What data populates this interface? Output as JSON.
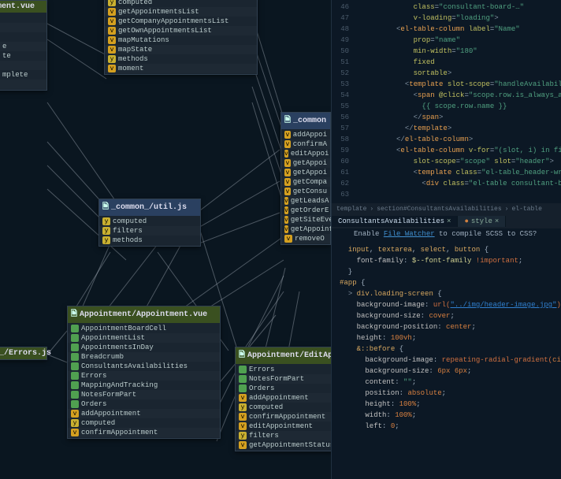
{
  "graph": {
    "nodes": {
      "nment": {
        "title": "nment.vue",
        "partial": true,
        "items": [
          {
            "icon": "g",
            "label": ""
          },
          {
            "icon": "g",
            "label": ""
          },
          {
            "icon": "g",
            "label": ""
          },
          {
            "icon": "b",
            "label": "e"
          },
          {
            "icon": "g",
            "label": "te"
          },
          {
            "icon": "g",
            "label": ""
          },
          {
            "icon": "b",
            "label": "mplete"
          },
          {
            "icon": "g",
            "label": ""
          }
        ]
      },
      "top": {
        "items": [
          {
            "icon": "y",
            "label": "computed"
          },
          {
            "icon": "v",
            "label": "getAppointmentsList"
          },
          {
            "icon": "v",
            "label": "getCompanyAppointmentsList"
          },
          {
            "icon": "v",
            "label": "getOwnAppointmentsList"
          },
          {
            "icon": "v",
            "label": "mapMutations"
          },
          {
            "icon": "v",
            "label": "mapState"
          },
          {
            "icon": "y",
            "label": "methods"
          },
          {
            "icon": "v",
            "label": "moment"
          }
        ]
      },
      "common_right": {
        "title": "_common",
        "headerClass": "alt",
        "items": [
          {
            "icon": "v",
            "label": "addAppoi"
          },
          {
            "icon": "v",
            "label": "confirmA"
          },
          {
            "icon": "v",
            "label": "editAppoi"
          },
          {
            "icon": "v",
            "label": "getAppoi"
          },
          {
            "icon": "v",
            "label": "getAppoi"
          },
          {
            "icon": "v",
            "label": "getCompa"
          },
          {
            "icon": "v",
            "label": "getConsu"
          },
          {
            "icon": "v",
            "label": "getLeadsA"
          },
          {
            "icon": "v",
            "label": "getOrderE"
          },
          {
            "icon": "v",
            "label": "getSiteEve"
          },
          {
            "icon": "v",
            "label": "getAppointmentStatusList"
          },
          {
            "icon": "v",
            "label": "removeO"
          }
        ]
      },
      "util": {
        "title": "_common_/util.js",
        "headerClass": "alt",
        "items": [
          {
            "icon": "y",
            "label": "computed"
          },
          {
            "icon": "y",
            "label": "filters"
          },
          {
            "icon": "y",
            "label": "methods"
          }
        ]
      },
      "appointment": {
        "title": "Appointment/Appointment.vue",
        "items": [
          {
            "icon": "g",
            "label": "AppointmentBoardCell"
          },
          {
            "icon": "g",
            "label": "AppointmentList"
          },
          {
            "icon": "g",
            "label": "AppointmentsInDay"
          },
          {
            "icon": "g",
            "label": "Breadcrumb"
          },
          {
            "icon": "g",
            "label": "ConsultantsAvailabilities"
          },
          {
            "icon": "g",
            "label": "Errors"
          },
          {
            "icon": "g",
            "label": "MappingAndTracking"
          },
          {
            "icon": "g",
            "label": "NotesFormPart"
          },
          {
            "icon": "g",
            "label": "Orders"
          },
          {
            "icon": "v",
            "label": "addAppointment"
          },
          {
            "icon": "y",
            "label": "computed"
          },
          {
            "icon": "v",
            "label": "confirmAppointment"
          }
        ]
      },
      "errors": {
        "title": "on_/Errors.js"
      },
      "edit": {
        "title": "Appointment/EditAppointment.vue",
        "items": [
          {
            "icon": "g",
            "label": "Errors"
          },
          {
            "icon": "g",
            "label": "NotesFormPart"
          },
          {
            "icon": "g",
            "label": "Orders"
          },
          {
            "icon": "v",
            "label": "addAppointment"
          },
          {
            "icon": "y",
            "label": "computed"
          },
          {
            "icon": "v",
            "label": "confirmAppointment"
          },
          {
            "icon": "v",
            "label": "editAppointment"
          },
          {
            "icon": "y",
            "label": "filters"
          },
          {
            "icon": "v",
            "label": "getAppointmentStatusList"
          }
        ]
      }
    }
  },
  "editor_top": {
    "line_start": 46,
    "lines": [
      {
        "indent": 14,
        "html": "<span class='attr'>class</span>=<span class='str'>\"consultant-board-…\"</span>"
      },
      {
        "indent": 14,
        "html": "<span class='attr'>v-loading</span>=<span class='str'>\"loading\"</span><span class='punct'>&gt;</span>"
      },
      {
        "indent": 10,
        "html": "<span class='punct'>&lt;</span><span class='tag'>el-table-column</span> <span class='attr'>label</span>=<span class='str'>\"Name\"</span>"
      },
      {
        "indent": 14,
        "html": "<span class='attr'>prop</span>=<span class='str'>\"name\"</span>"
      },
      {
        "indent": 14,
        "html": "<span class='attr'>min-width</span>=<span class='str'>\"180\"</span>"
      },
      {
        "indent": 14,
        "html": "<span class='attr'>fixed</span>"
      },
      {
        "indent": 14,
        "html": "<span class='attr'>sortable</span><span class='punct'>&gt;</span>"
      },
      {
        "indent": 12,
        "html": "<span class='punct'>&lt;</span><span class='tag'>template</span> <span class='attr'>slot-scope</span>=<span class='str'>\"handleAvailability(scope.row)\"</span>"
      },
      {
        "indent": 14,
        "html": "<span class='punct'>&lt;</span><span class='tag'>span</span> <span class='attr'>@click</span>=<span class='str'>\"scope.row.is_always_available ?</span>"
      },
      {
        "indent": 16,
        "html": "<span class='str'>{{ scope.row.name }}</span>"
      },
      {
        "indent": 14,
        "html": "<span class='punct'>&lt;/</span><span class='tag'>span</span><span class='punct'>&gt;</span>"
      },
      {
        "indent": 12,
        "html": "<span class='punct'>&lt;/</span><span class='tag'>template</span><span class='punct'>&gt;</span>"
      },
      {
        "indent": 10,
        "html": "<span class='punct'>&lt;/</span><span class='tag'>el-table-column</span><span class='punct'>&gt;</span>"
      },
      {
        "indent": 0,
        "html": ""
      },
      {
        "indent": 10,
        "html": "<span class='punct'>&lt;</span><span class='tag'>el-table-column</span> <span class='attr'>v-for</span>=<span class='str'>\"(slot, i) in firstHeader\"</span> <span class='attr'>:k</span>"
      },
      {
        "indent": 14,
        "html": "<span class='attr'>slot-scope</span>=<span class='str'>\"scope\"</span> <span class='attr'>slot</span>=<span class='str'>\"header\"</span><span class='punct'>&gt;</span>"
      },
      {
        "indent": 14,
        "html": "<span class='punct'>&lt;</span><span class='tag'>template</span> <span class='attr'>class</span>=<span class='str'>\"el-table_header-wrap\"</span><span class='punct'>&gt;</span>"
      },
      {
        "indent": 16,
        "html": "<span class='punct'>&lt;</span><span class='tag'>div</span> <span class='attr'>class</span>=<span class='str'>\"el-table consultant-board-ta</span>"
      }
    ]
  },
  "editor_bottom": {
    "breadcrumb": [
      "template",
      "section#ConsultantsAvailabilities",
      "el-table"
    ],
    "tabs": [
      {
        "label": "ConsultantsAvailabilities",
        "active": true,
        "close": true
      },
      {
        "label": "style",
        "active": false,
        "close": true
      }
    ],
    "tip_prefix": "Enable ",
    "tip_link": "File Watcher",
    "tip_suffix": " to compile SCSS to CSS?",
    "lines": [
      {
        "indent": 2,
        "html": "<span class='sel'>input</span>, <span class='sel'>textarea</span>, <span class='sel'>select</span>, <span class='sel'>button</span> {"
      },
      {
        "indent": 4,
        "html": "<span class='prop'>font-family</span>: <span class='ident'>$--font-family</span> <span class='kw'>!important</span>;"
      },
      {
        "indent": 2,
        "html": "}"
      },
      {
        "indent": 0,
        "html": ""
      },
      {
        "indent": 0,
        "html": "<span class='sel'>#app</span> {"
      },
      {
        "indent": 2,
        "html": "<span class='punct'>&gt;</span> <span class='sel'>div.loading-screen</span> {"
      },
      {
        "indent": 4,
        "html": "<span class='prop'>background-image</span>: <span class='kw'>url(</span><span class='url-u'>\"../img/header-image.jpg\"</span><span class='kw'>)</span>;"
      },
      {
        "indent": 4,
        "html": "<span class='prop'>background-size</span>: <span class='val'>cover</span>;"
      },
      {
        "indent": 4,
        "html": "<span class='prop'>background-position</span>: <span class='val'>center</span>;"
      },
      {
        "indent": 4,
        "html": "<span class='prop'>height</span>: <span class='val'>100vh</span>;"
      },
      {
        "indent": 0,
        "html": ""
      },
      {
        "indent": 4,
        "html": "<span class='sel'>&amp;::before</span> {"
      },
      {
        "indent": 6,
        "html": "<span class='prop'>background-image</span>: <span class='kw'>repeating-radial-gradient(</span><span class='val'>circle</span>"
      },
      {
        "indent": 6,
        "html": "<span class='prop'>background-size</span>: <span class='val'>6px 6px</span>;"
      },
      {
        "indent": 6,
        "html": "<span class='prop'>content</span>: <span class='str'>\"\"</span>;"
      },
      {
        "indent": 6,
        "html": "<span class='prop'>position</span>: <span class='val'>absolute</span>;"
      },
      {
        "indent": 6,
        "html": "<span class='prop'>height</span>: <span class='val'>100%</span>;"
      },
      {
        "indent": 6,
        "html": "<span class='prop'>width</span>: <span class='val'>100%</span>;"
      },
      {
        "indent": 6,
        "html": "<span class='prop'>left</span>: <span class='val'>0</span>;"
      }
    ]
  }
}
